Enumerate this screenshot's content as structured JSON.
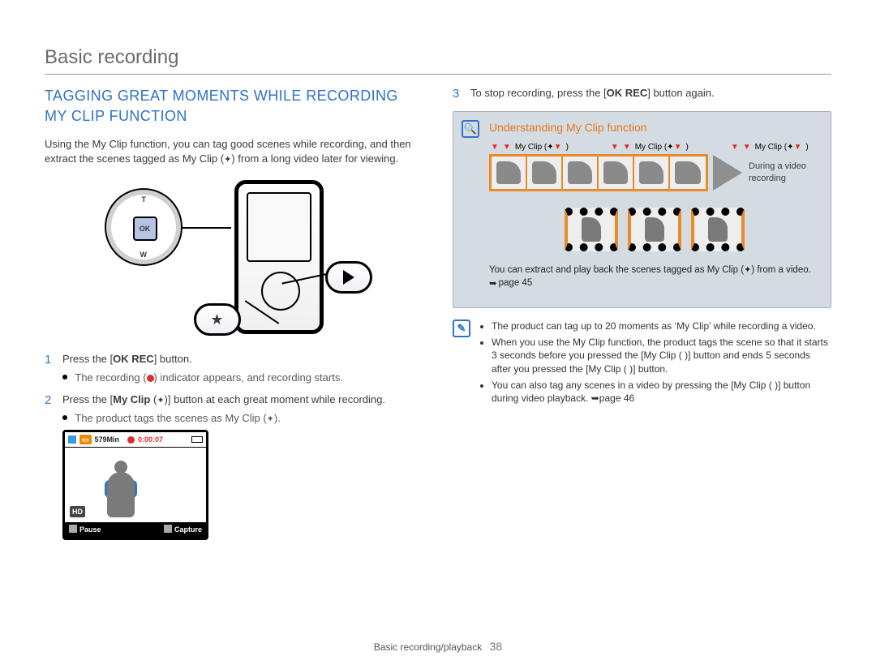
{
  "page": {
    "title": "Basic recording",
    "footer_section": "Basic recording/playback",
    "page_number": "38"
  },
  "left": {
    "heading": "TAGGING GREAT MOMENTS WHILE RECORDING MY CLIP FUNCTION",
    "intro_a": "Using the My Clip function, you can tag good scenes while recording, and then extract the scenes tagged as My Clip (",
    "intro_b": ") from a long video later for viewing.",
    "dpad": {
      "ok": "OK",
      "t": "T",
      "w": "W"
    },
    "steps": [
      {
        "num": "1",
        "text_parts": [
          "Press the [",
          "OK REC",
          "] button."
        ],
        "sub_parts": [
          "The recording (",
          "red-dot",
          ") indicator appears, and recording starts."
        ]
      },
      {
        "num": "2",
        "text_parts": [
          "Press the [",
          "My Clip",
          " (",
          "clip-icon",
          ")] button at each great moment while recording."
        ],
        "sub_parts": [
          "The product tags the scenes as My Clip (",
          "clip-icon",
          ")."
        ]
      }
    ],
    "preview": {
      "minutes": "579Min",
      "time": "0:00:07",
      "hd": "HD",
      "pause": "Pause",
      "capture": "Capture"
    }
  },
  "right": {
    "step3": {
      "num": "3",
      "text_parts": [
        "To stop recording, press the [",
        "OK REC",
        "] button again."
      ]
    },
    "panel": {
      "title": "Understanding My Clip function",
      "pin_label": "My Clip (",
      "pin_label_close": ")",
      "caption": "During a video recording",
      "note_a": "You can extract and play back the scenes tagged as My Clip (",
      "note_b": ") from a video. ",
      "note_page": "page 45"
    },
    "info": [
      "The product can tag up to 20 moments as ‘My Clip’ while recording a video.",
      "When you use the My Clip function, the product tags the scene so that it starts 3 seconds before you pressed the [My Clip ( )] button and ends 5 seconds after you pressed the [My Clip ( )] button.",
      "You can also tag any scenes in a video by pressing the [My Clip ( )] button during video playback. ➥page 46"
    ]
  }
}
